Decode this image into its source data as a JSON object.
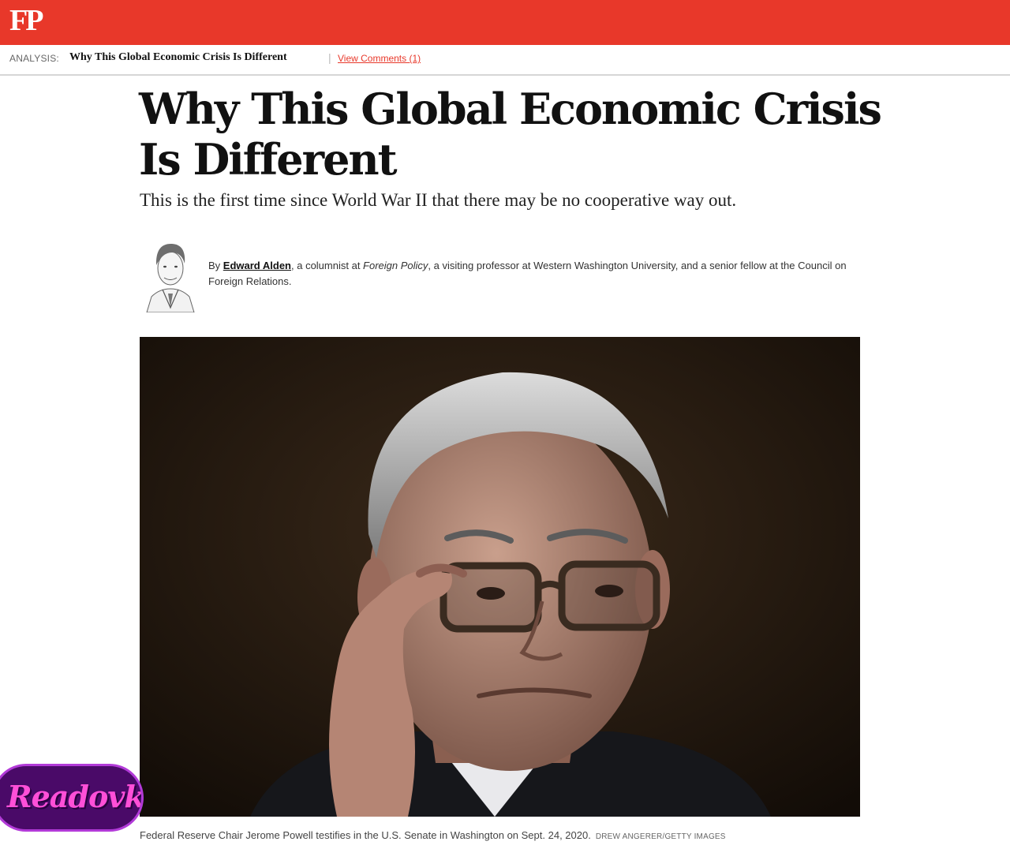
{
  "header": {
    "logo": "FP",
    "brand_color": "#e8382a"
  },
  "subbar": {
    "kicker": "ANALYSIS:",
    "title": "Why This Global Economic Crisis Is Different",
    "separator": "|",
    "comments_link": "View Comments (1)"
  },
  "article": {
    "headline": "Why This Global Economic Crisis Is Different",
    "dek": "This is the first time since World War II that there may be no cooperative way out.",
    "byline": {
      "prefix": "By ",
      "author": "Edward Alden",
      "text_1": ", a columnist at ",
      "publication": "Foreign Policy",
      "text_2": ", a visiting professor at Western Washington University, and a senior fellow at the Council on Foreign Relations."
    },
    "hero_image": {
      "caption": "Federal Reserve Chair Jerome Powell testifies in the U.S. Senate in Washington on Sept. 24, 2020.",
      "credit": "DREW ANGERER/GETTY IMAGES"
    }
  },
  "watermark": {
    "text": "Readovka"
  }
}
